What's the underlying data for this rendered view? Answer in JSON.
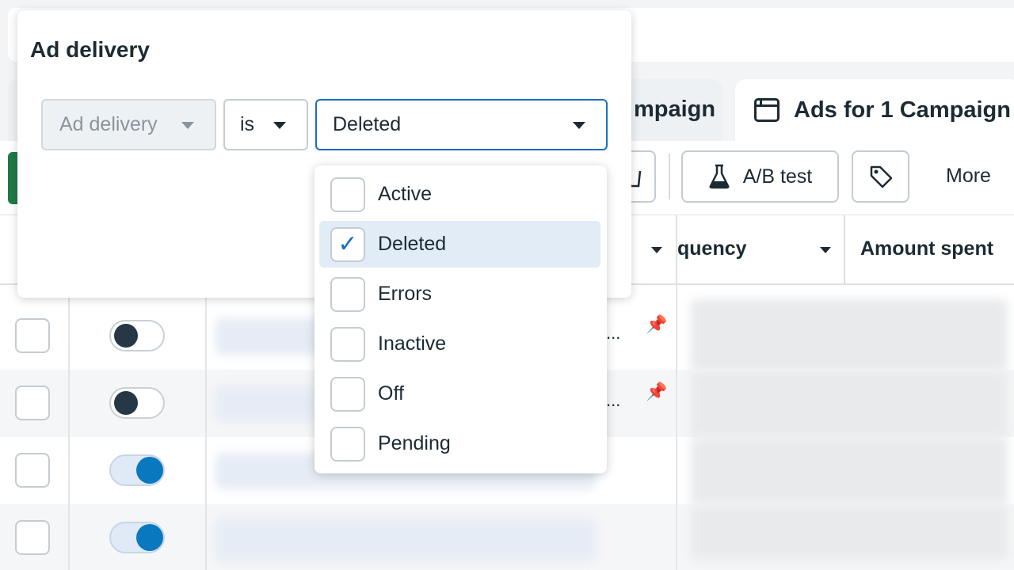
{
  "tabs": {
    "campaigns_label": "mpaign",
    "ads_label": "Ads for 1 Campaign"
  },
  "toolbar": {
    "ab_test_label": "A/B test",
    "more_label": "More"
  },
  "table": {
    "headers": {
      "frequency": "quency",
      "amount_spent": "Amount spent"
    },
    "rows": [
      {
        "toggle": "off",
        "ellipsis": "...",
        "pinned": true
      },
      {
        "toggle": "off",
        "ellipsis": "...",
        "pinned": true
      },
      {
        "toggle": "on"
      },
      {
        "toggle": "on"
      }
    ]
  },
  "filter": {
    "title": "Ad delivery",
    "field": "Ad delivery",
    "operator": "is",
    "value": "Deleted",
    "options": [
      {
        "label": "Active",
        "checked": false
      },
      {
        "label": "Deleted",
        "checked": true
      },
      {
        "label": "Errors",
        "checked": false
      },
      {
        "label": "Inactive",
        "checked": false
      },
      {
        "label": "Off",
        "checked": false
      },
      {
        "label": "Pending",
        "checked": false
      }
    ]
  },
  "colors": {
    "accent": "#1a6ec1",
    "toggle_on": "#0a78be",
    "create_green": "#1e7a46"
  }
}
